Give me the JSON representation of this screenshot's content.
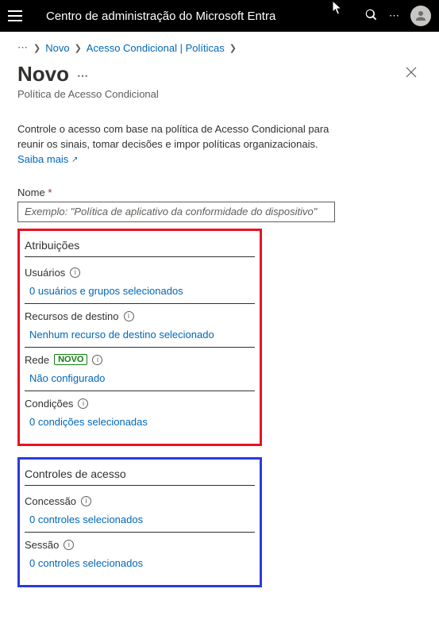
{
  "topbar": {
    "title": "Centro de administração do Microsoft Entra"
  },
  "breadcrumb": {
    "more": "⋯",
    "items": [
      "Novo",
      "Acesso Condicional | Políticas"
    ]
  },
  "page": {
    "title": "Novo",
    "subtitle": "Política de Acesso Condicional"
  },
  "intro": {
    "text": "Controle o acesso com base na política de Acesso Condicional para reunir os sinais, tomar decisões e impor políticas organizacionais. ",
    "link": "Saiba mais"
  },
  "nameField": {
    "label": "Nome",
    "placeholder": "Exemplo: \"Política de aplicativo da conformidade do dispositivo\""
  },
  "assignments": {
    "title": "Atribuições",
    "users": {
      "label": "Usuários",
      "link": "0 usuários e grupos selecionados"
    },
    "resources": {
      "label": "Recursos de destino",
      "link": "Nenhum recurso de destino selecionado"
    },
    "network": {
      "label": "Rede",
      "badge": "NOVO",
      "link": "Não configurado"
    },
    "conditions": {
      "label": "Condições",
      "link": "0 condições selecionadas"
    }
  },
  "access": {
    "title": "Controles de acesso",
    "grant": {
      "label": "Concessão",
      "link": "0 controles selecionados"
    },
    "session": {
      "label": "Sessão",
      "link": "0 controles selecionados"
    }
  }
}
